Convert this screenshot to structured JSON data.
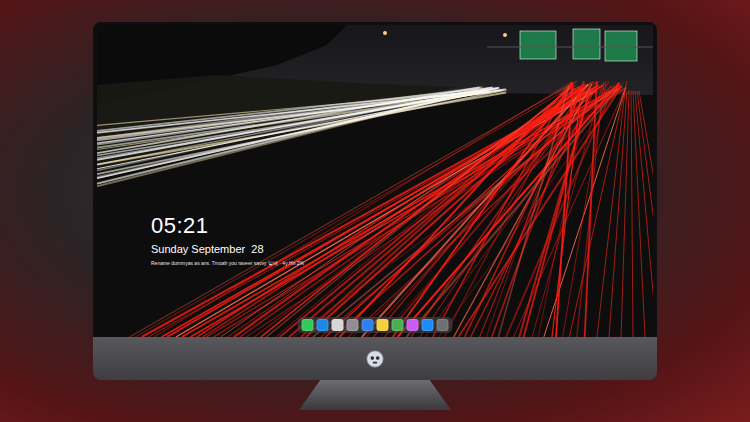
{
  "lock_screen": {
    "time": "05:21",
    "date": "Sunday September  28",
    "notice": "Rename dummyas as ans. Tmoah you raveer savvy 일에 · 4y Hn 2%"
  },
  "dock": [
    {
      "color": "#34c759"
    },
    {
      "color": "#1e88e5"
    },
    {
      "color": "#d6d6d6"
    },
    {
      "color": "#8e8e93"
    },
    {
      "color": "#2f80ed"
    },
    {
      "color": "#f5d142"
    },
    {
      "color": "#4caf50"
    },
    {
      "color": "#c65cf0"
    },
    {
      "color": "#1d8cf8"
    },
    {
      "color": "#6e6e73"
    }
  ]
}
